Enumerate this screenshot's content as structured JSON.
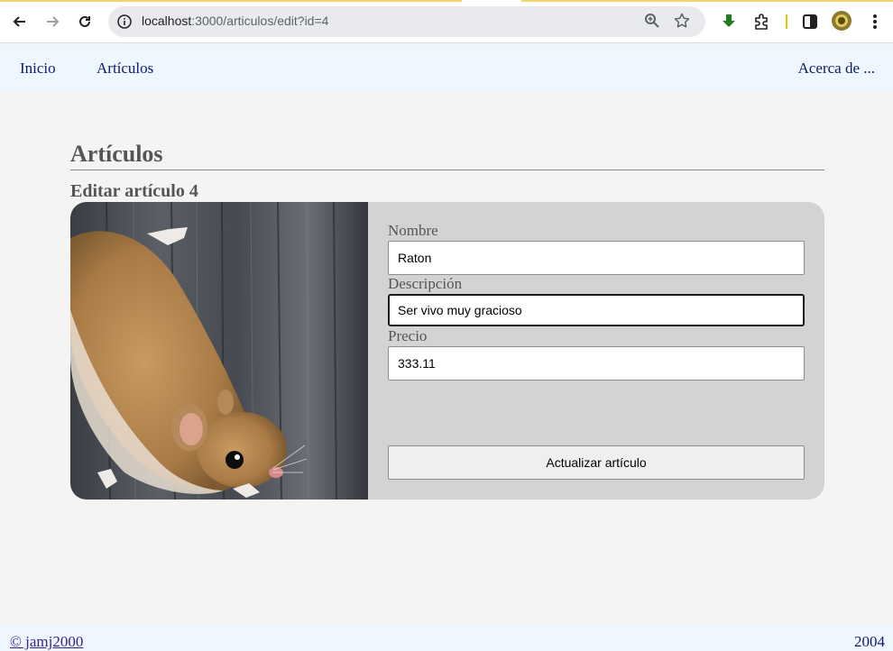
{
  "browser": {
    "url_host": "localhost",
    "url_path": ":3000/articulos/edit?id=4"
  },
  "nav": {
    "home": "Inicio",
    "articles": "Artículos",
    "about": "Acerca de ..."
  },
  "page": {
    "title": "Artículos",
    "subtitle": "Editar artículo 4"
  },
  "form": {
    "image_icon": "mouse-photo",
    "name_label": "Nombre",
    "name_value": "Raton",
    "description_label": "Descripción",
    "description_value": "Ser vivo muy gracioso",
    "price_label": "Precio",
    "price_value": "333.11",
    "submit_label": "Actualizar artículo"
  },
  "footer": {
    "copyright": "© jamj2000",
    "year": "2004"
  },
  "colors": {
    "nav_bg": "#eef6ff",
    "card_bg": "#d3d3d3",
    "link": "#0b1a6e"
  }
}
